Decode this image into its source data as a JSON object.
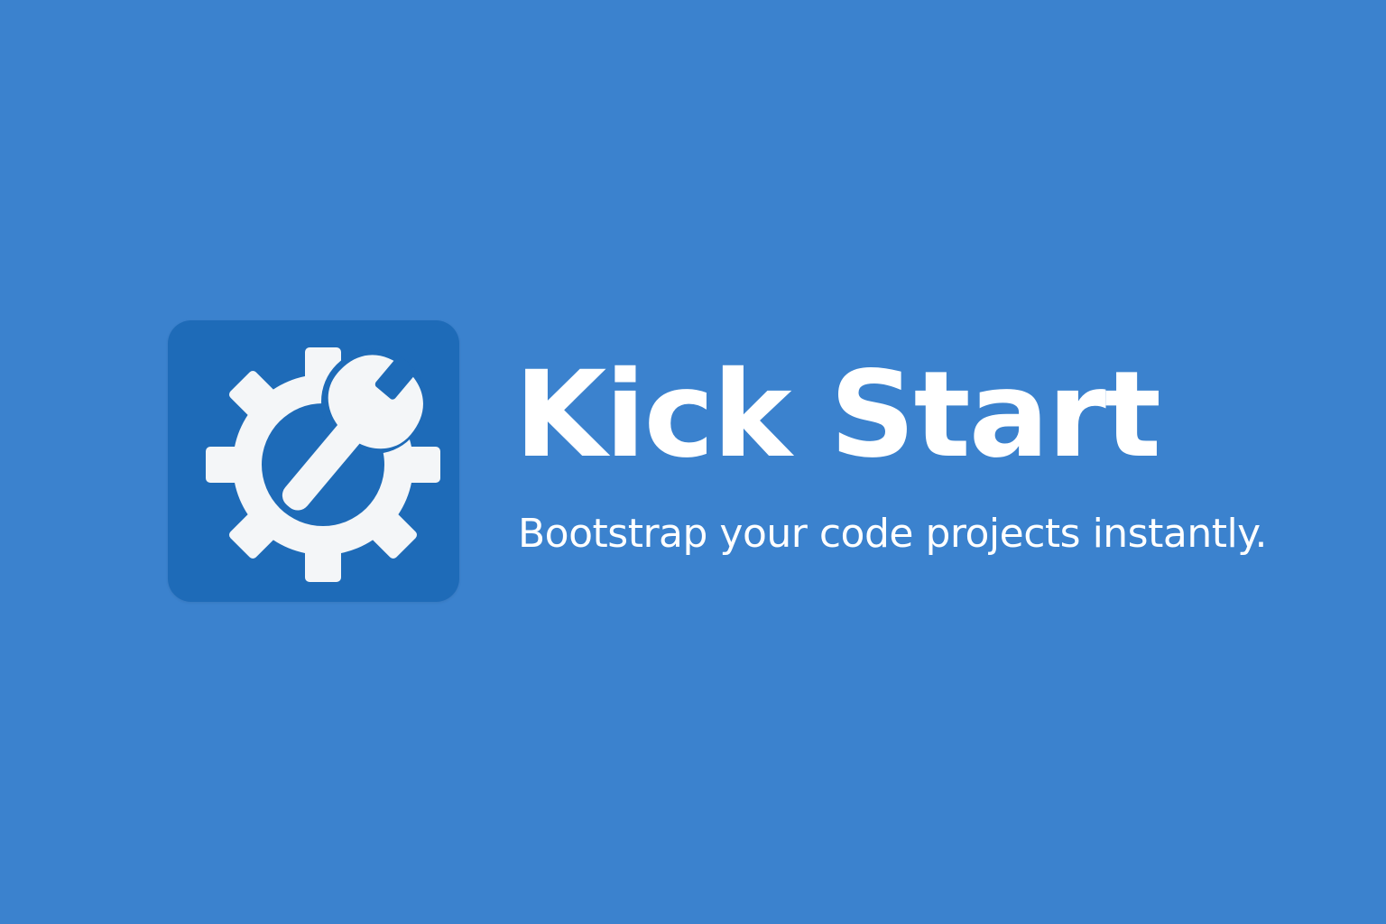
{
  "brand": {
    "name": "Kick Start",
    "tagline": "Bootstrap your code projects instantly.",
    "logo_icon": "gear-wrench-icon"
  },
  "colors": {
    "background": "#3b82ce",
    "logo_tile": "#1e6bb8",
    "foreground": "#ffffff"
  }
}
